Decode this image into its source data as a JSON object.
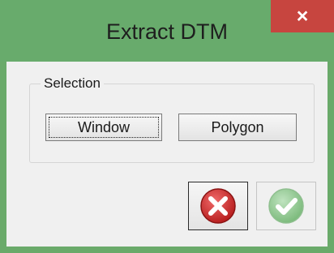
{
  "window": {
    "title": "Extract DTM",
    "close_glyph": "×",
    "frame_color": "#68ab6c"
  },
  "selection_group": {
    "label": "Selection",
    "window_button": "Window",
    "polygon_button": "Polygon"
  },
  "actions": {
    "cancel_icon": "red-x-circle-icon",
    "ok_icon": "green-check-circle-icon",
    "ok_enabled": false
  }
}
